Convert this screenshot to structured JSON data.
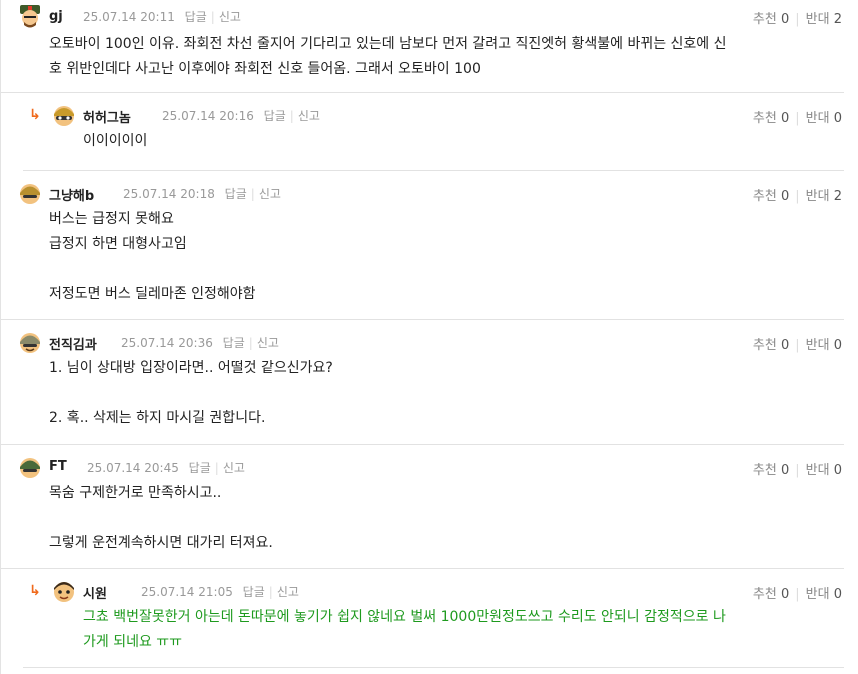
{
  "comments": [
    {
      "nick": "gj",
      "time": "25.07.14 20:11",
      "reply_label": "답글",
      "report_label": "신고",
      "up_label": "추천",
      "up": "0",
      "down_label": "반대",
      "down": "2",
      "lines": [
        "오토바이 100인 이유. 좌회전 차선 줄지어 기다리고 있는데 남보다 먼저 갈려고 직진엣허 황색불에 바뀌는 신호에 신",
        "호 위반인데다 사고난 이후에야 좌회전 신호 들어옴. 그래서 오토바이 100"
      ]
    },
    {
      "reply_arrow": "↳",
      "nick": "허허그놈",
      "time": "25.07.14 20:16",
      "reply_label": "답글",
      "report_label": "신고",
      "up_label": "추천",
      "up": "0",
      "down_label": "반대",
      "down": "0",
      "lines": [
        "이이이이이"
      ]
    },
    {
      "nick": "그냥해b",
      "time": "25.07.14 20:18",
      "reply_label": "답글",
      "report_label": "신고",
      "up_label": "추천",
      "up": "0",
      "down_label": "반대",
      "down": "2",
      "lines": [
        "버스는 급정지 못해요",
        "급정지 하면 대형사고임",
        "",
        "저정도면 버스 딜레마존 인정해야함"
      ]
    },
    {
      "nick": "전직김과",
      "time": "25.07.14 20:36",
      "reply_label": "답글",
      "report_label": "신고",
      "up_label": "추천",
      "up": "0",
      "down_label": "반대",
      "down": "0",
      "lines": [
        "1. 님이 상대방 입장이라면.. 어떨것 같으신가요?",
        "",
        "2. 혹.. 삭제는 하지 마시길 권합니다."
      ]
    },
    {
      "nick": "FT",
      "time": "25.07.14 20:45",
      "reply_label": "답글",
      "report_label": "신고",
      "up_label": "추천",
      "up": "0",
      "down_label": "반대",
      "down": "0",
      "lines": [
        "목숨 구제한거로 만족하시고..",
        "",
        "그렇게 운전계속하시면 대가리 터져요."
      ]
    },
    {
      "reply_arrow": "↳",
      "nick": "시원",
      "time": "25.07.14 21:05",
      "reply_label": "답글",
      "report_label": "신고",
      "up_label": "추천",
      "up": "0",
      "down_label": "반대",
      "down": "0",
      "lines": [
        "그쵸 백번잘못한거 아는데 돈따문에 놓기가 쉽지 않네요 벌써 1000만원정도쓰고 수리도 안되니 감정적으로 나",
        "가게 되네요 ㅠㅠ"
      ]
    }
  ],
  "colors": {
    "reply_text": "#1e9a1e",
    "reply_arrow": "#f06a1c",
    "meta": "#999999",
    "divider": "#e2e2e2"
  }
}
